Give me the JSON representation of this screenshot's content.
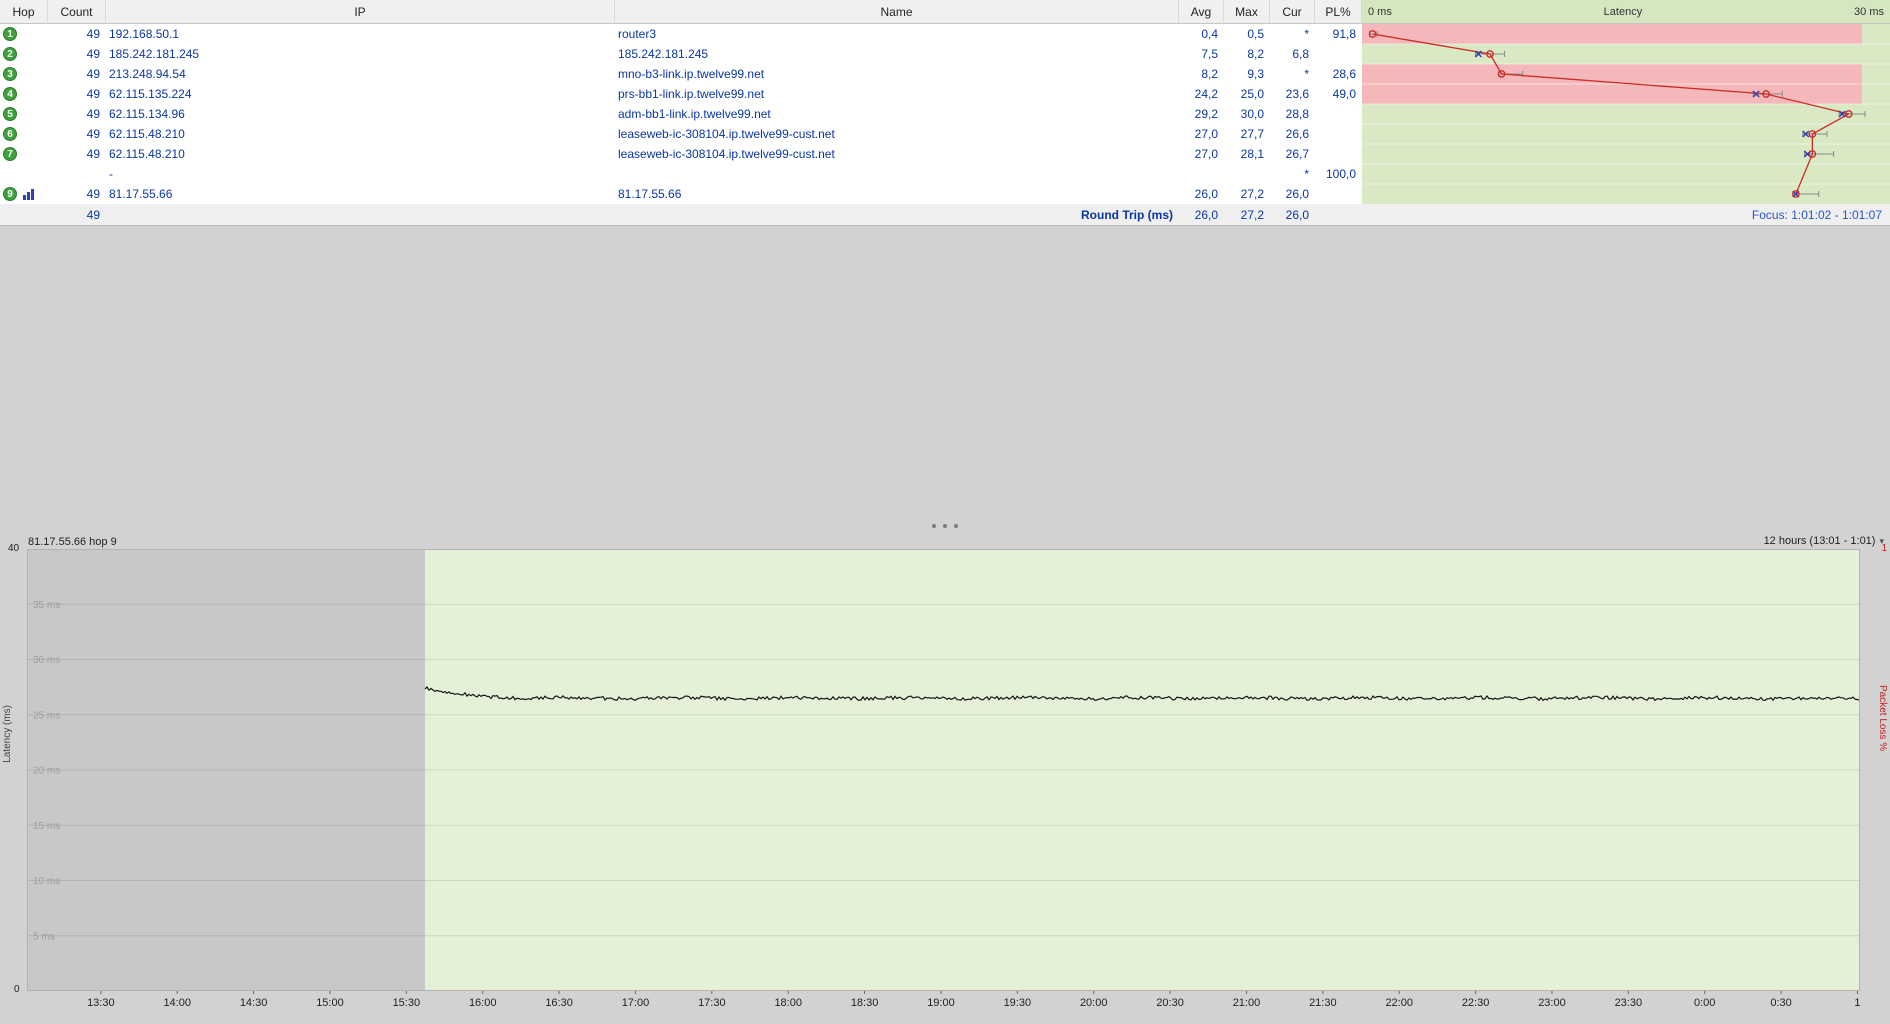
{
  "trace": {
    "columns": [
      "Hop",
      "Count",
      "IP",
      "Name",
      "Avg",
      "Max",
      "Cur",
      "PL%"
    ],
    "latency_header": {
      "left": "0 ms",
      "center": "Latency",
      "right": "30 ms"
    },
    "scale_max_ms": 30,
    "rows": [
      {
        "hop": "1",
        "count": "49",
        "ip": "192.168.50.1",
        "name": "router3",
        "avg": "0,4",
        "max": "0,5",
        "cur": "*",
        "pl": "91,8",
        "band": "red"
      },
      {
        "hop": "2",
        "count": "49",
        "ip": "185.242.181.245",
        "name": "185.242.181.245",
        "avg": "7,5",
        "max": "8,2",
        "cur": "6,8",
        "pl": "",
        "band": "green"
      },
      {
        "hop": "3",
        "count": "49",
        "ip": "213.248.94.54",
        "name": "mno-b3-link.ip.twelve99.net",
        "avg": "8,2",
        "max": "9,3",
        "cur": "*",
        "pl": "28,6",
        "band": "red"
      },
      {
        "hop": "4",
        "count": "49",
        "ip": "62.115.135.224",
        "name": "prs-bb1-link.ip.twelve99.net",
        "avg": "24,2",
        "max": "25,0",
        "cur": "23,6",
        "pl": "49,0",
        "band": "red"
      },
      {
        "hop": "5",
        "count": "49",
        "ip": "62.115.134.96",
        "name": "adm-bb1-link.ip.twelve99.net",
        "avg": "29,2",
        "max": "30,0",
        "cur": "28,8",
        "pl": "",
        "band": "green"
      },
      {
        "hop": "6",
        "count": "49",
        "ip": "62.115.48.210",
        "name": "leaseweb-ic-308104.ip.twelve99-cust.net",
        "avg": "27,0",
        "max": "27,7",
        "cur": "26,6",
        "pl": "",
        "band": "green"
      },
      {
        "hop": "7",
        "count": "49",
        "ip": "62.115.48.210",
        "name": "leaseweb-ic-308104.ip.twelve99-cust.net",
        "avg": "27,0",
        "max": "28,1",
        "cur": "26,7",
        "pl": "",
        "band": "green"
      },
      {
        "hop": "",
        "count": "",
        "ip": "-",
        "name": "",
        "avg": "",
        "max": "",
        "cur": "*",
        "pl": "100,0",
        "band": "green"
      },
      {
        "hop": "9",
        "count": "49",
        "ip": "81.17.55.66",
        "name": "81.17.55.66",
        "avg": "26,0",
        "max": "27,2",
        "cur": "26,0",
        "pl": "",
        "band": "green",
        "graph_icon": true
      }
    ],
    "footer": {
      "count": "49",
      "label": "Round Trip (ms)",
      "avg": "26,0",
      "max": "27,2",
      "cur": "26,0",
      "focus": "Focus: 1:01:02 - 1:01:07"
    }
  },
  "timeline": {
    "title": "81.17.55.66 hop 9",
    "range_label": "12 hours (13:01 - 1:01)",
    "y_axis_label": "Latency (ms)",
    "y_top_label": "40",
    "y_bottom_label": "0",
    "y_max_ms": 40,
    "right_axis_label": "Packet Loss %",
    "right_axis_top_label": "1",
    "gridlines_ms": [
      35,
      30,
      25,
      20,
      15,
      10,
      5
    ],
    "gridline_suffix": " ms",
    "x_labels": [
      "13:30",
      "14:00",
      "14:30",
      "15:00",
      "15:30",
      "16:00",
      "16:30",
      "17:00",
      "17:30",
      "18:00",
      "18:30",
      "19:00",
      "19:30",
      "20:00",
      "20:30",
      "21:00",
      "21:30",
      "22:00",
      "22:30",
      "23:00",
      "23:30",
      "0:00",
      "0:30",
      "1"
    ],
    "start_time_min": 781,
    "span_min": 720,
    "latency_series": {
      "approx_value_ms": 26.5,
      "data_start_frac": 0.217
    }
  },
  "colors": {
    "text_navy": "#0a36a3",
    "band_green": "#d8e9c4",
    "band_red": "#f4b8ba",
    "latency_line_red": "#cf2a27",
    "marker_blue": "#2d3fb5",
    "whisker_gray": "#8a8a8a",
    "plot_green": "#e5f0d8",
    "plot_gray": "#c8c8c8",
    "series_black": "#151515",
    "focus_blue": "#2456c8",
    "packet_loss_red": "#c02020",
    "hop_badge_green": "#3da23c"
  }
}
